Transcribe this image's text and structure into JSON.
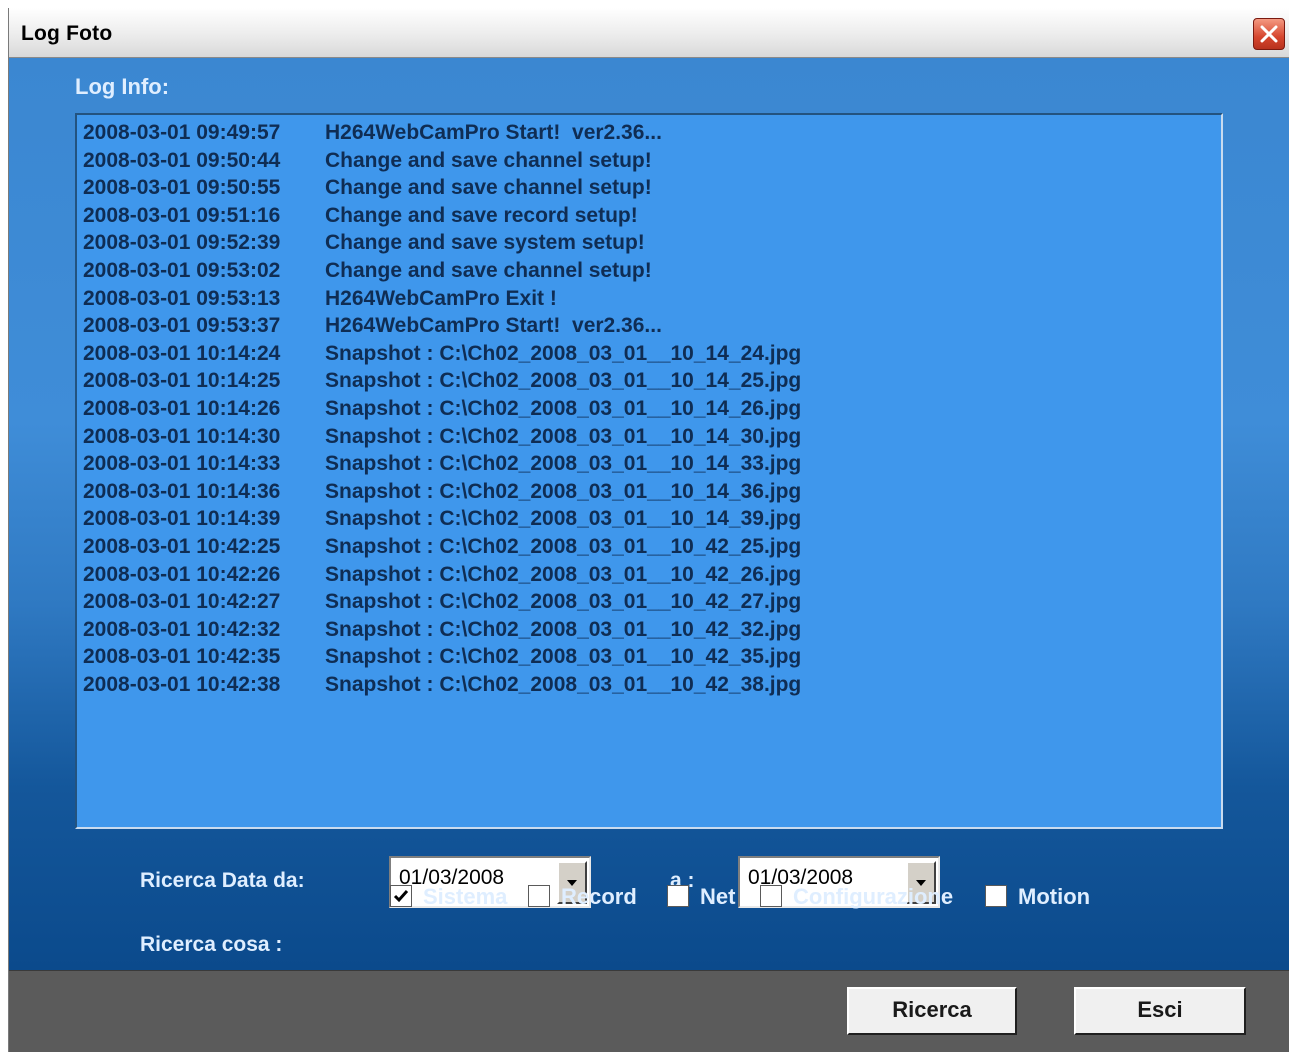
{
  "window": {
    "title": "Log Foto",
    "close_icon": "close-icon",
    "accent_color": "#3d83c8"
  },
  "log": {
    "label": "Log Info:",
    "entries": [
      {
        "ts": "2008-03-01 09:49:57",
        "msg": "H264WebCamPro Start!  ver2.36..."
      },
      {
        "ts": "2008-03-01 09:50:44",
        "msg": "Change and save channel setup!"
      },
      {
        "ts": "2008-03-01 09:50:55",
        "msg": "Change and save channel setup!"
      },
      {
        "ts": "2008-03-01 09:51:16",
        "msg": "Change and save record setup!"
      },
      {
        "ts": "2008-03-01 09:52:39",
        "msg": "Change and save system setup!"
      },
      {
        "ts": "2008-03-01 09:53:02",
        "msg": "Change and save channel setup!"
      },
      {
        "ts": "2008-03-01 09:53:13",
        "msg": "H264WebCamPro Exit !"
      },
      {
        "ts": "2008-03-01 09:53:37",
        "msg": "H264WebCamPro Start!  ver2.36..."
      },
      {
        "ts": "2008-03-01 10:14:24",
        "msg": "Snapshot : C:\\Ch02_2008_03_01__10_14_24.jpg"
      },
      {
        "ts": "2008-03-01 10:14:25",
        "msg": "Snapshot : C:\\Ch02_2008_03_01__10_14_25.jpg"
      },
      {
        "ts": "2008-03-01 10:14:26",
        "msg": "Snapshot : C:\\Ch02_2008_03_01__10_14_26.jpg"
      },
      {
        "ts": "2008-03-01 10:14:30",
        "msg": "Snapshot : C:\\Ch02_2008_03_01__10_14_30.jpg"
      },
      {
        "ts": "2008-03-01 10:14:33",
        "msg": "Snapshot : C:\\Ch02_2008_03_01__10_14_33.jpg"
      },
      {
        "ts": "2008-03-01 10:14:36",
        "msg": "Snapshot : C:\\Ch02_2008_03_01__10_14_36.jpg"
      },
      {
        "ts": "2008-03-01 10:14:39",
        "msg": "Snapshot : C:\\Ch02_2008_03_01__10_14_39.jpg"
      },
      {
        "ts": "2008-03-01 10:42:25",
        "msg": "Snapshot : C:\\Ch02_2008_03_01__10_42_25.jpg"
      },
      {
        "ts": "2008-03-01 10:42:26",
        "msg": "Snapshot : C:\\Ch02_2008_03_01__10_42_26.jpg"
      },
      {
        "ts": "2008-03-01 10:42:27",
        "msg": "Snapshot : C:\\Ch02_2008_03_01__10_42_27.jpg"
      },
      {
        "ts": "2008-03-01 10:42:32",
        "msg": "Snapshot : C:\\Ch02_2008_03_01__10_42_32.jpg"
      },
      {
        "ts": "2008-03-01 10:42:35",
        "msg": "Snapshot : C:\\Ch02_2008_03_01__10_42_35.jpg"
      },
      {
        "ts": "2008-03-01 10:42:38",
        "msg": "Snapshot : C:\\Ch02_2008_03_01__10_42_38.jpg"
      }
    ]
  },
  "search": {
    "date_from_label": "Ricerca Data da:",
    "date_from_value": "01/03/2008",
    "date_to_label": "a :",
    "date_to_value": "01/03/2008",
    "dropdown_icon": "chevron-down-icon",
    "what_label": "Ricerca cosa :",
    "checkboxes": [
      {
        "label": "Sistema",
        "checked": true
      },
      {
        "label": "Record",
        "checked": false
      },
      {
        "label": "Net",
        "checked": false
      },
      {
        "label": "Configurazione",
        "checked": false
      },
      {
        "label": "Motion",
        "checked": false
      }
    ]
  },
  "buttons": {
    "search_label": "Ricerca",
    "exit_label": "Esci"
  }
}
